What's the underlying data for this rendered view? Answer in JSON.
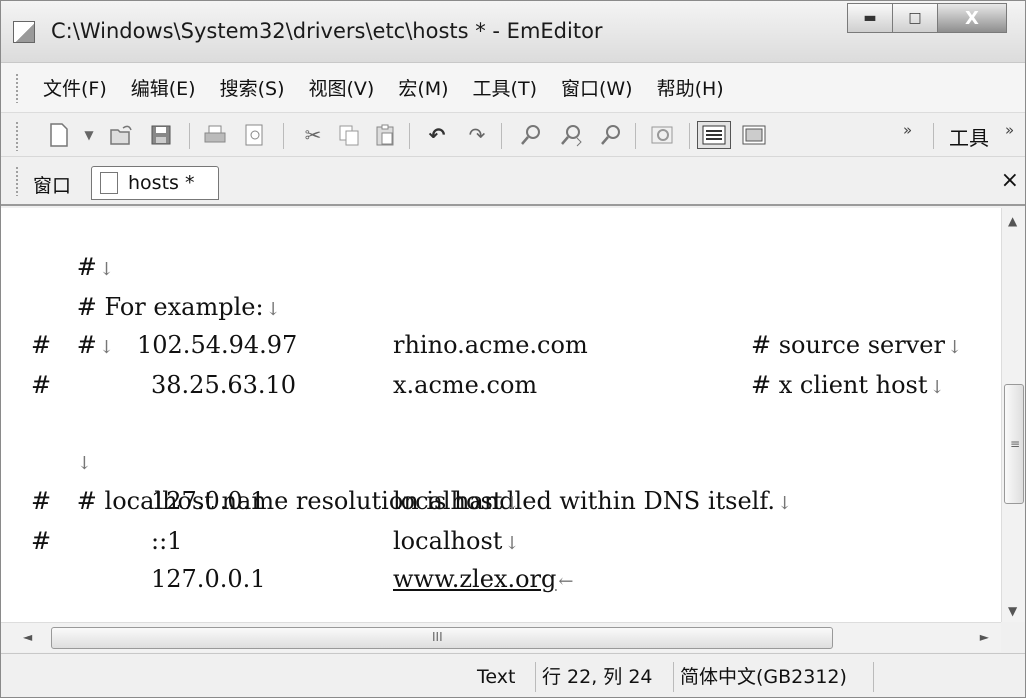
{
  "window": {
    "title": "C:\\Windows\\System32\\drivers\\etc\\hosts * - EmEditor",
    "minimize_symbol": "▬",
    "maximize_symbol": "□",
    "close_symbol": "X"
  },
  "menu": {
    "items": [
      "文件(F)",
      "编辑(E)",
      "搜索(S)",
      "视图(V)",
      "宏(M)",
      "工具(T)",
      "窗口(W)",
      "帮助(H)"
    ]
  },
  "toolbar": {
    "tools_label": "工具",
    "overflow_symbol": "»",
    "icons": [
      "new-file-icon",
      "dropdown-arrow-icon",
      "open-file-icon",
      "save-icon",
      "print-icon",
      "print-preview-icon",
      "cut-icon",
      "copy-icon",
      "paste-icon",
      "undo-icon",
      "redo-icon",
      "find-icon",
      "find-next-icon",
      "find-previous-icon",
      "clear-highlight-icon",
      "wrap-none-icon",
      "wrap-window-icon"
    ]
  },
  "tabs": {
    "window_label": "窗口",
    "items": [
      {
        "label": "hosts *"
      }
    ],
    "close_symbol": "×"
  },
  "editor": {
    "lines": [
      {
        "c1": "#",
        "mark": "↓"
      },
      {
        "c1": "# For example:",
        "mark": "↓"
      },
      {
        "c1": "#",
        "mark": "↓"
      },
      {
        "c1": "#",
        "ip": "102.54.94.97",
        "host": "rhino.acme.com",
        "comment": "# source server",
        "mark": "↓"
      },
      {
        "c1": "#",
        "ip": "38.25.63.10",
        "host": "x.acme.com",
        "comment": "# x client host",
        "mark": "↓"
      },
      {
        "c1": "",
        "mark": "↓"
      },
      {
        "c1": "# localhost name resolution is handled within DNS itself.",
        "mark": "↓"
      },
      {
        "c1": "#",
        "ip": "127.0.0.1",
        "host": "localhost",
        "mark": "↓"
      },
      {
        "c1": "#",
        "ip": "::1",
        "host": "localhost",
        "mark": "↓"
      },
      {
        "c1": "",
        "ip": "127.0.0.1",
        "host": "www.zlex.org",
        "mark": "←"
      }
    ]
  },
  "scrollbars": {
    "up": "▲",
    "down": "▼",
    "left": "◄",
    "right": "►",
    "v_grip": "≡",
    "h_grip": "III"
  },
  "status": {
    "mode": "Text",
    "position": "行 22, 列 24",
    "encoding": "简体中文(GB2312)"
  }
}
